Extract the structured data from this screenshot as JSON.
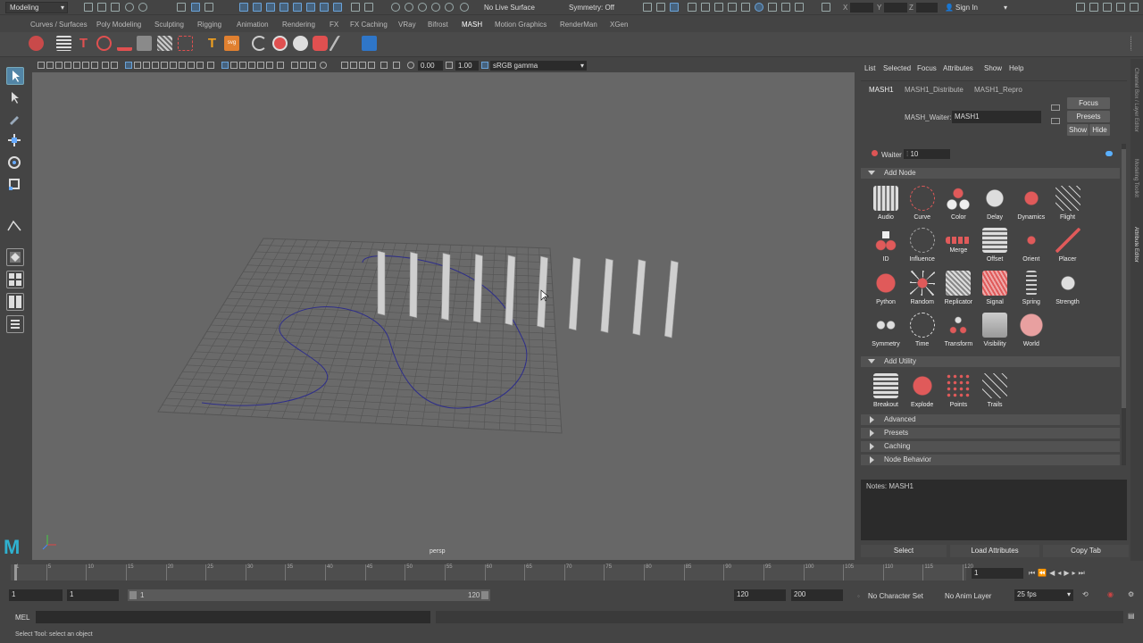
{
  "app": {
    "workspace": "Modeling"
  },
  "topbar": {
    "live_surface": "No Live Surface",
    "symmetry": "Symmetry: Off",
    "signin": "Sign In"
  },
  "shelf_tabs": [
    "Curves / Surfaces",
    "Poly Modeling",
    "Sculpting",
    "Rigging",
    "Animation",
    "Rendering",
    "FX",
    "FX Caching",
    "VRay",
    "Bifrost",
    "MASH",
    "Motion Graphics",
    "RenderMan",
    "XGen"
  ],
  "shelf_active": "MASH",
  "viewport": {
    "exposure": "0.00",
    "gamma": "1.00",
    "colorspace": "sRGB gamma",
    "camera": "persp"
  },
  "panel": {
    "menu": [
      "List",
      "Selected",
      "Focus",
      "Attributes",
      "Show",
      "Help"
    ],
    "tabs": [
      "MASH1",
      "MASH1_Distribute",
      "MASH1_Repro"
    ],
    "waiter_label": "MASH_Waiter:",
    "waiter_value": "MASH1",
    "focus": "Focus",
    "presets": "Presets",
    "show": "Show",
    "hide": "Hide",
    "waiter_row_label": "Waiter",
    "waiter_row_value": "10",
    "add_node": "Add Node",
    "nodes": [
      "Audio",
      "Curve",
      "Color",
      "Delay",
      "Dynamics",
      "Flight",
      "ID",
      "Influence",
      "Merge",
      "Offset",
      "Orient",
      "Placer",
      "Python",
      "Random",
      "Replicator",
      "Signal",
      "Spring",
      "Strength",
      "Symmetry",
      "Time",
      "Transform",
      "Visibility",
      "World"
    ],
    "add_utility": "Add Utility",
    "utilities": [
      "Breakout",
      "Explode",
      "Points",
      "Trails"
    ],
    "collapsed": [
      "Advanced",
      "Presets",
      "Caching",
      "Node Behavior"
    ],
    "notes": "Notes:  MASH1",
    "bottom": [
      "Select",
      "Load Attributes",
      "Copy Tab"
    ]
  },
  "timeline": {
    "ticks": [
      "1",
      "5",
      "10",
      "15",
      "20",
      "25",
      "30",
      "35",
      "40",
      "45",
      "50",
      "55",
      "60",
      "65",
      "70",
      "75",
      "80",
      "85",
      "90",
      "95",
      "100",
      "105",
      "110",
      "115",
      "120"
    ],
    "current": "1"
  },
  "range": {
    "start": "1",
    "start2": "1",
    "slider_start": "1",
    "slider_end": "120",
    "end": "120",
    "end2": "200",
    "char_set": "No Character Set",
    "anim_layer": "No Anim Layer",
    "fps": "25 fps"
  },
  "cmd": {
    "label": "MEL"
  },
  "status": {
    "text": "Select Tool: select an object"
  }
}
